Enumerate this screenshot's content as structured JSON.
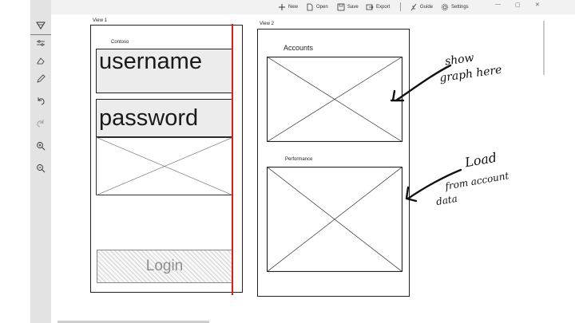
{
  "toolbar": {
    "new": "New",
    "open": "Open",
    "save": "Save",
    "export": "Export",
    "guide": "Guide",
    "settings": "Settings"
  },
  "sidebar": {
    "tools": [
      "select-icon",
      "adjust-icon",
      "eraser-icon",
      "pen-icon",
      "undo-icon",
      "redo-icon",
      "zoom-in-icon",
      "zoom-out-icon"
    ]
  },
  "view1": {
    "label": "View 1",
    "brand": "Contoso",
    "username": "username",
    "password": "password",
    "login": "Login"
  },
  "view2": {
    "label": "View 2",
    "accounts": "Accounts",
    "performance": "Performance"
  },
  "annotations": {
    "note1": [
      "show",
      "graph here"
    ],
    "note2": [
      "Load",
      "from account",
      "data"
    ]
  },
  "colors": {
    "accent": "#4a88c7",
    "redline": "#d91f1f"
  }
}
